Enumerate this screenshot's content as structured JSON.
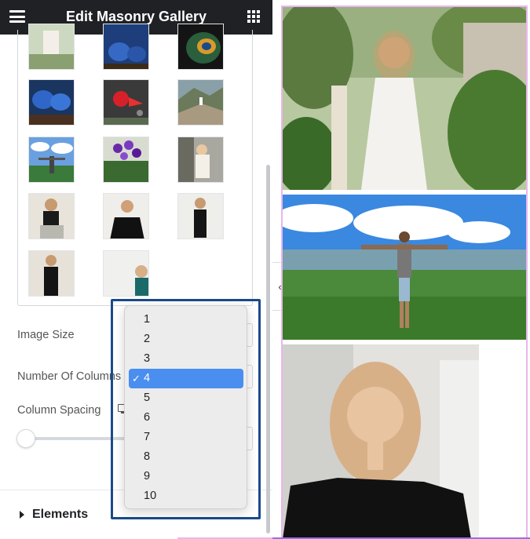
{
  "header": {
    "title": "Edit Masonry Gallery",
    "menu_icon": "hamburger-icon",
    "apps_icon": "grid-icon"
  },
  "fields": {
    "image_size_label": "Image Size",
    "columns_label": "Number Of Columns",
    "spacing_label": "Column Spacing",
    "responsive_icon": "monitor-icon"
  },
  "dropdown": {
    "options": [
      "1",
      "2",
      "3",
      "4",
      "5",
      "6",
      "7",
      "8",
      "9",
      "10"
    ],
    "selected": "4",
    "check_mark": "✓"
  },
  "section": {
    "elements_label": "Elements"
  },
  "collapse": {
    "chevron": "‹"
  },
  "colors": {
    "header_bg": "#1f2124",
    "selection_blue": "#4a8ef0",
    "highlight_border": "#1a4a8a",
    "preview_border": "#e9b6ee"
  }
}
